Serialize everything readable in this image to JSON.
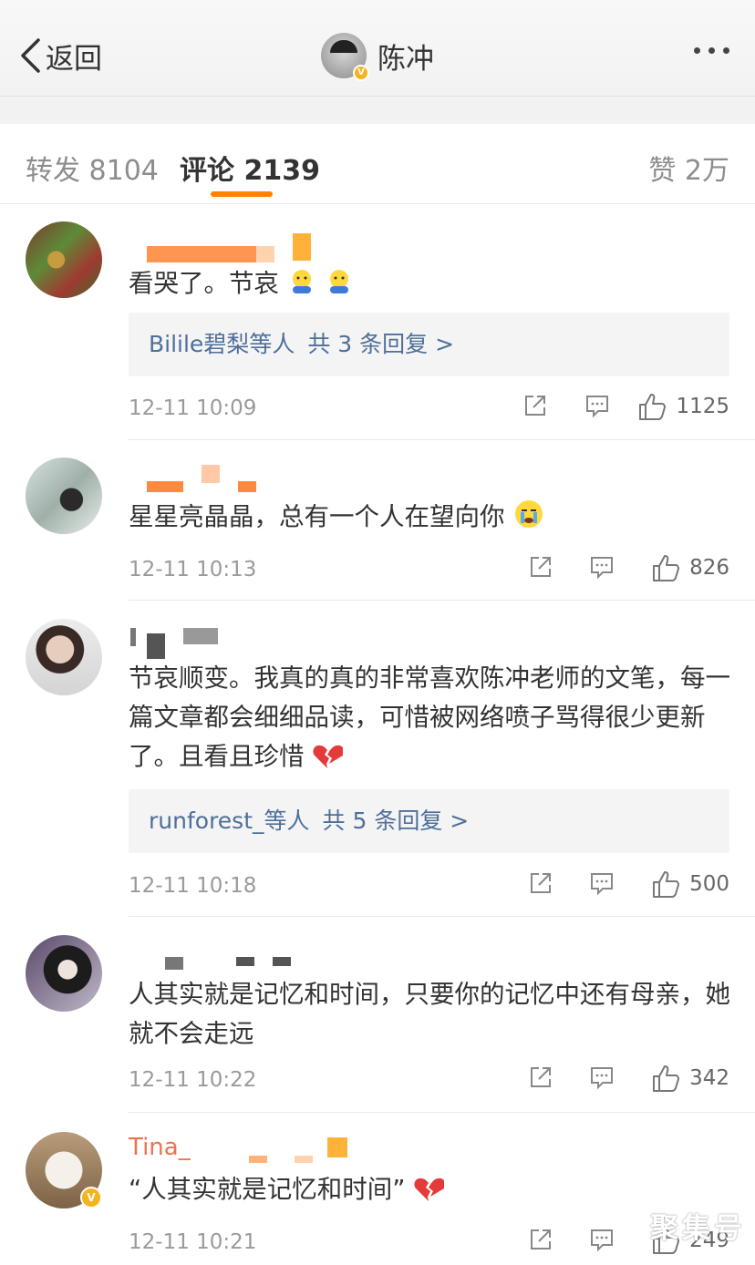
{
  "nav": {
    "back_label": "返回",
    "title": "陈冲",
    "verified": "V"
  },
  "tabs": {
    "repost": "转发 8104",
    "comment": "评论 2139",
    "like": "赞 2万"
  },
  "comments": [
    {
      "name": "",
      "text": "看哭了。节哀",
      "emoji": [
        "hug-emoji",
        "hug-emoji"
      ],
      "replies": {
        "who": "Bilile碧梨等人",
        "count": "共 3 条回复 >"
      },
      "time": "12-11 10:09",
      "likes": "1125"
    },
    {
      "name": "",
      "text": "星星亮晶晶，总有一个人在望向你",
      "emoji": [
        "crying-emoji"
      ],
      "replies": null,
      "time": "12-11 10:13",
      "likes": "826"
    },
    {
      "name": "",
      "text": "节哀顺变。我真的真的非常喜欢陈冲老师的文笔，每一篇文章都会细细品读，可惜被网络喷子骂得很少更新了。且看且珍惜",
      "emoji": [
        "broken-heart-emoji"
      ],
      "replies": {
        "who": "runforest_等人",
        "count": "共 5 条回复 >"
      },
      "time": "12-11 10:18",
      "likes": "500"
    },
    {
      "name": "",
      "text": "人其实就是记忆和时间，只要你的记忆中还有母亲，她就不会走远",
      "emoji": [],
      "replies": null,
      "time": "12-11 10:22",
      "likes": "342"
    },
    {
      "name": "Tina_",
      "text": "“人其实就是记忆和时间”",
      "emoji": [
        "broken-heart-emoji"
      ],
      "replies": null,
      "time": "12-11 10:21",
      "likes": "249"
    }
  ],
  "watermark": "聚集号",
  "colors": {
    "accent": "#ff8200",
    "link": "#4e6f99",
    "name": "#eb7350",
    "verified": "#f5b31e"
  }
}
